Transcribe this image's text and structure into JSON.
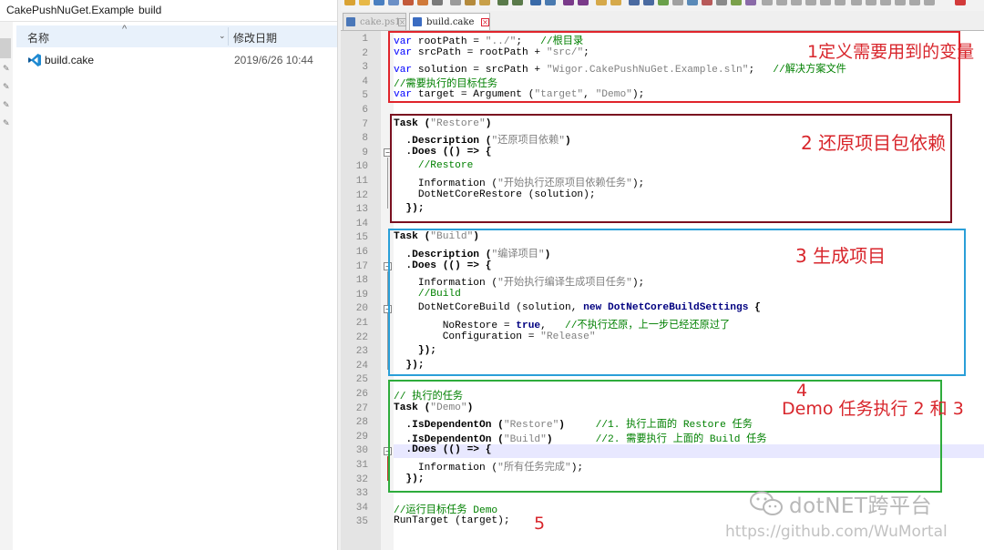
{
  "explorer": {
    "breadcrumb": [
      "CakePushNuGet.Example",
      "build"
    ],
    "breadcrumb_sep": "›",
    "column_name": "名称",
    "column_date": "修改日期",
    "sort_indicator": "^",
    "file": {
      "name": "build.cake",
      "modified": "2019/6/26 10:44",
      "icon": "vscode-icon"
    }
  },
  "editor": {
    "tabs": [
      {
        "label": "cake.ps1",
        "close": "×",
        "active": false
      },
      {
        "label": "build.cake",
        "close": "×",
        "active": true
      }
    ],
    "current_line": 30,
    "colors": {
      "keyword": "#0000ff",
      "comment": "#008000",
      "string": "#808080",
      "gutter": "#e4e4e4",
      "current_line": "#e8e8ff"
    }
  },
  "lines": [
    [
      [
        "kw",
        "var"
      ],
      [
        "",
        "rootPath = "
      ],
      [
        "st",
        "\"../\""
      ],
      [
        "",
        ";   "
      ],
      [
        "cm",
        "//根目录"
      ]
    ],
    [
      [
        "kw",
        "var"
      ],
      [
        "",
        "srcPath = rootPath + "
      ],
      [
        "st",
        "\"src/\""
      ],
      [
        "",
        ";"
      ]
    ],
    [
      [
        "kw",
        "var"
      ],
      [
        "",
        "solution = srcPath + "
      ],
      [
        "st",
        "\"Wigor.CakePushNuGet.Example.sln\""
      ],
      [
        "",
        ";   "
      ],
      [
        "cm",
        "//解决方案文件"
      ]
    ],
    [
      [
        "cm",
        "//需要执行的目标任务"
      ]
    ],
    [
      [
        "kw",
        "var"
      ],
      [
        "",
        "target = Argument ("
      ],
      [
        "st",
        "\"target\""
      ],
      [
        "",
        ", "
      ],
      [
        "st",
        "\"Demo\""
      ],
      [
        "",
        ");"
      ]
    ],
    [],
    [
      [
        "bd",
        "Task"
      ],
      [
        "bd",
        " ("
      ],
      [
        "st",
        "\"Restore\""
      ],
      [
        "bd",
        ")"
      ]
    ],
    [
      [
        "bd",
        "  .Description"
      ],
      [
        "bd",
        " ("
      ],
      [
        "st",
        "\"还原项目依赖\""
      ],
      [
        "bd",
        ")"
      ]
    ],
    [
      [
        "bd",
        "  .Does"
      ],
      [
        "bd",
        " (() => {"
      ]
    ],
    [
      [
        "cm",
        "    //Restore"
      ]
    ],
    [
      [
        "",
        "    Information ("
      ],
      [
        "st",
        "\"开始执行还原项目依赖任务\""
      ],
      [
        "",
        ");"
      ]
    ],
    [
      [
        "",
        "    DotNetCoreRestore (solution);"
      ]
    ],
    [
      [
        "bd",
        "  });"
      ]
    ],
    [],
    [
      [
        "bd",
        "Task"
      ],
      [
        "bd",
        " ("
      ],
      [
        "st",
        "\"Build\""
      ],
      [
        "bd",
        ")"
      ]
    ],
    [
      [
        "bd",
        "  .Description"
      ],
      [
        "bd",
        " ("
      ],
      [
        "st",
        "\"编译项目\""
      ],
      [
        "bd",
        ")"
      ]
    ],
    [
      [
        "bd",
        "  .Does"
      ],
      [
        "bd",
        " (() => {"
      ]
    ],
    [
      [
        "",
        "    Information ("
      ],
      [
        "st",
        "\"开始执行编译生成项目任务\""
      ],
      [
        "",
        ");"
      ]
    ],
    [
      [
        "cm",
        "    //Build"
      ]
    ],
    [
      [
        "",
        "    DotNetCoreBuild (solution, "
      ],
      [
        "ty",
        "new"
      ],
      [
        "",
        ""
      ],
      [
        "ty",
        " DotNetCoreBuildSettings"
      ],
      [
        "bd",
        " {"
      ]
    ],
    [
      [
        "",
        "        NoRestore = "
      ],
      [
        "ty",
        "true"
      ],
      [
        "",
        ",   "
      ],
      [
        "cm",
        "//不执行还原，上一步已经还原过了"
      ]
    ],
    [
      [
        "",
        "        Configuration = "
      ],
      [
        "st",
        "\"Release\""
      ]
    ],
    [
      [
        "bd",
        "    });"
      ]
    ],
    [
      [
        "bd",
        "  });"
      ]
    ],
    [],
    [
      [
        "cm",
        "// 执行的任务"
      ]
    ],
    [
      [
        "bd",
        "Task"
      ],
      [
        "bd",
        " ("
      ],
      [
        "st",
        "\"Demo\""
      ],
      [
        "bd",
        ")"
      ]
    ],
    [
      [
        "bd",
        "  .IsDependentOn"
      ],
      [
        "bd",
        " ("
      ],
      [
        "st",
        "\"Restore\""
      ],
      [
        "bd",
        ")"
      ],
      [
        "",
        "     "
      ],
      [
        "cm",
        "//1. 执行上面的 Restore 任务"
      ]
    ],
    [
      [
        "bd",
        "  .IsDependentOn"
      ],
      [
        "bd",
        " ("
      ],
      [
        "st",
        "\"Build\""
      ],
      [
        "bd",
        ")"
      ],
      [
        "",
        "       "
      ],
      [
        "cm",
        "//2. 需要执行 上面的 Build 任务"
      ]
    ],
    [
      [
        "bd",
        "  .Does"
      ],
      [
        "bd",
        " (() => {"
      ]
    ],
    [
      [
        "",
        "    Information ("
      ],
      [
        "st",
        "\"所有任务完成\""
      ],
      [
        "",
        ");"
      ]
    ],
    [
      [
        "bd",
        "  });"
      ]
    ],
    [],
    [
      [
        "cm",
        "//运行目标任务 Demo"
      ]
    ],
    [
      [
        "",
        "RunTarget (target);"
      ]
    ]
  ],
  "annotations": [
    {
      "text": "1定义需要用到的变量",
      "color": "#d8262c"
    },
    {
      "text": "2 还原项目包依赖",
      "color": "#d8262c"
    },
    {
      "text": "3  生成项目",
      "color": "#d8262c"
    },
    {
      "text": "4",
      "color": "#d8262c"
    },
    {
      "text": "Demo 任务执行 2 和 3",
      "color": "#d8262c"
    },
    {
      "text": "5",
      "color": "#d8262c"
    }
  ],
  "box_colors": {
    "vars": "#e0242b",
    "restore": "#7a1020",
    "build": "#2a9fd8",
    "demo": "#2eac3c",
    "gutter_mark": "#c0392b"
  },
  "watermark": {
    "brand": "dotNET跨平台",
    "url": "https://github.com/WuMortal"
  }
}
